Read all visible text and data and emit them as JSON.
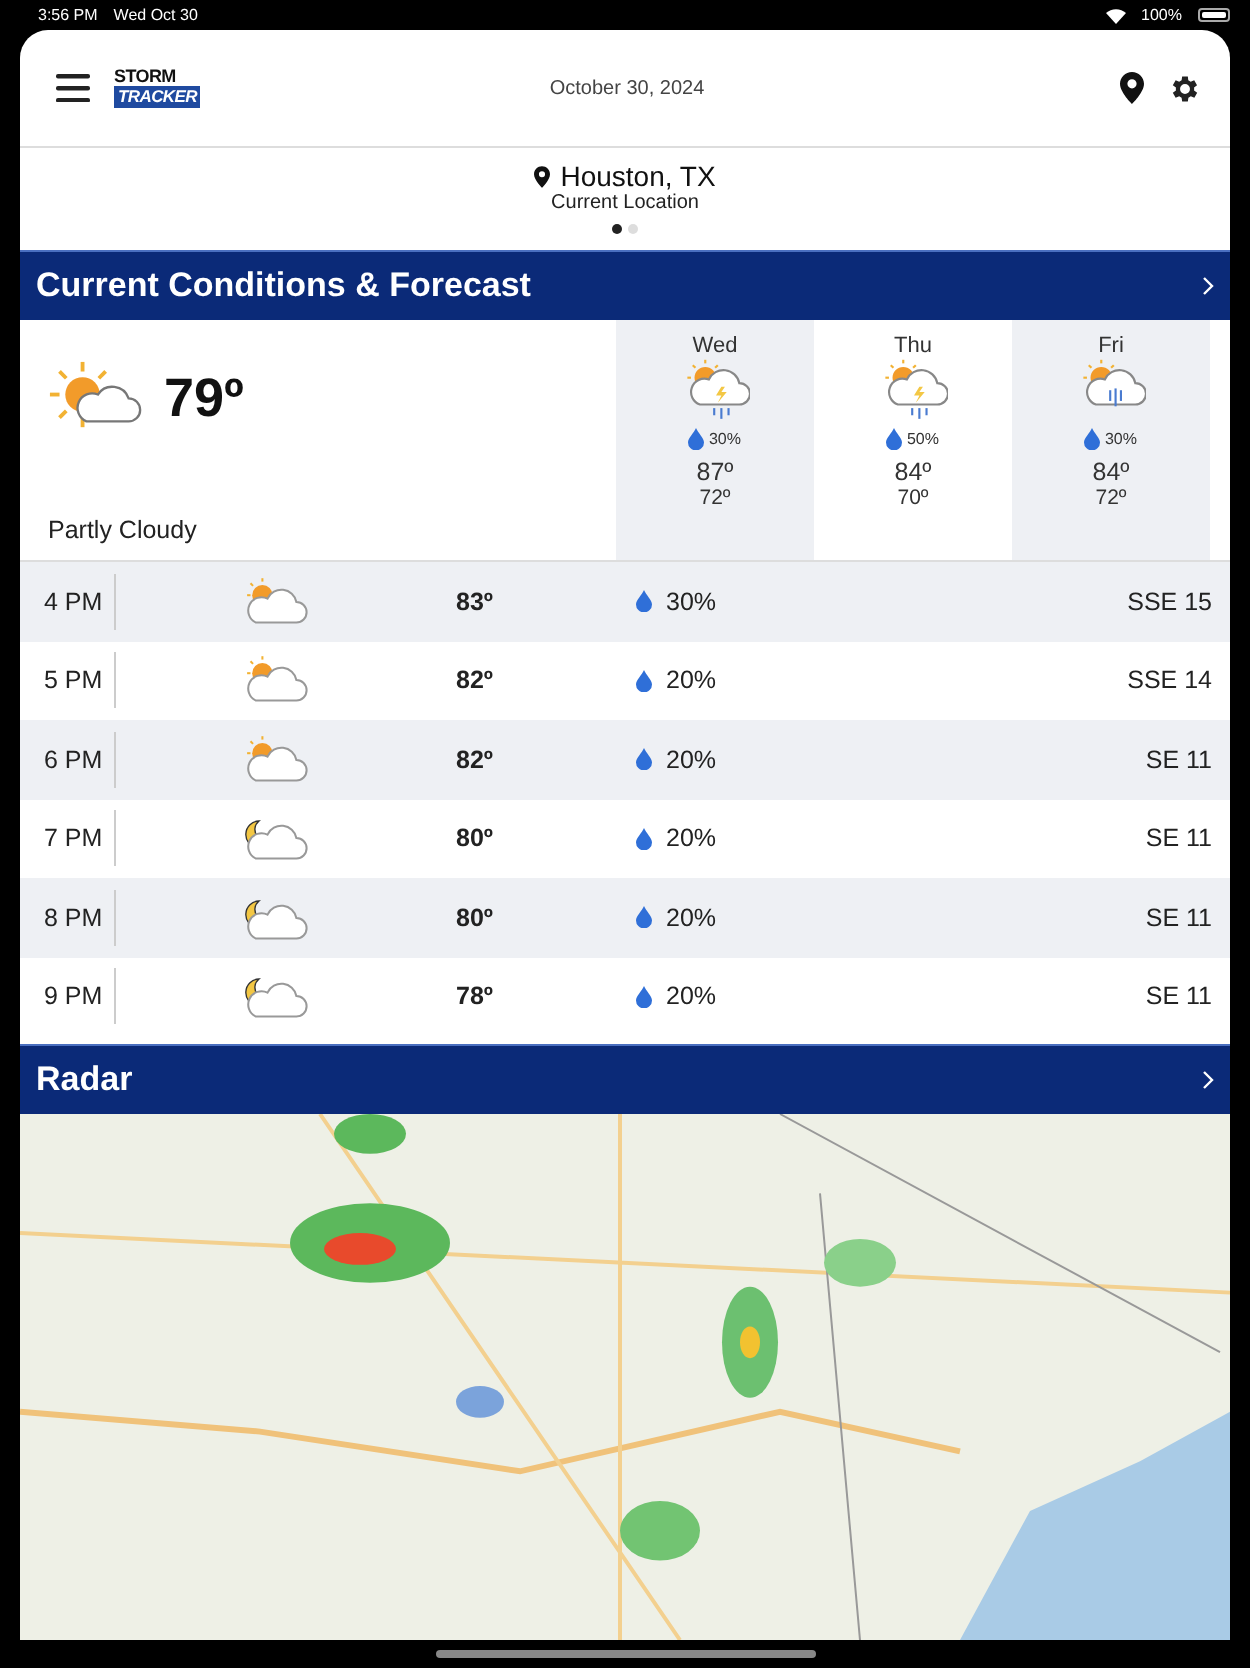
{
  "status_bar": {
    "time": "3:56 PM",
    "date": "Wed Oct 30",
    "battery": "100%"
  },
  "header": {
    "logo": [
      "STORM",
      "TRACKER"
    ],
    "date": "October 30, 2024"
  },
  "location": {
    "city": "Houston, TX",
    "subtitle": "Current Location",
    "pages": [
      {
        "selected": true
      },
      {
        "selected": false
      }
    ]
  },
  "conditions": {
    "title": "Current Conditions & Forecast",
    "temperature": "79º",
    "summary": "Partly Cloudy",
    "forecast": [
      {
        "day": "Wed",
        "kind": "storm",
        "precip": "30%",
        "high": "87º",
        "low": "72º"
      },
      {
        "day": "Thu",
        "kind": "storm",
        "precip": "50%",
        "high": "84º",
        "low": "70º"
      },
      {
        "day": "Fri",
        "kind": "rain",
        "precip": "30%",
        "high": "84º",
        "low": "72º"
      }
    ]
  },
  "hourly": [
    {
      "time": "4 PM",
      "kind": "day",
      "temp": "83º",
      "precip": "30%",
      "wind": "SSE 15"
    },
    {
      "time": "5 PM",
      "kind": "day",
      "temp": "82º",
      "precip": "20%",
      "wind": "SSE 14"
    },
    {
      "time": "6 PM",
      "kind": "day",
      "temp": "82º",
      "precip": "20%",
      "wind": "SE 11"
    },
    {
      "time": "7 PM",
      "kind": "night",
      "temp": "80º",
      "precip": "20%",
      "wind": "SE 11"
    },
    {
      "time": "8 PM",
      "kind": "night",
      "temp": "80º",
      "precip": "20%",
      "wind": "SE 11"
    },
    {
      "time": "9 PM",
      "kind": "night",
      "temp": "78º",
      "precip": "20%",
      "wind": "SE 11"
    }
  ],
  "radar": {
    "title": "Radar"
  }
}
